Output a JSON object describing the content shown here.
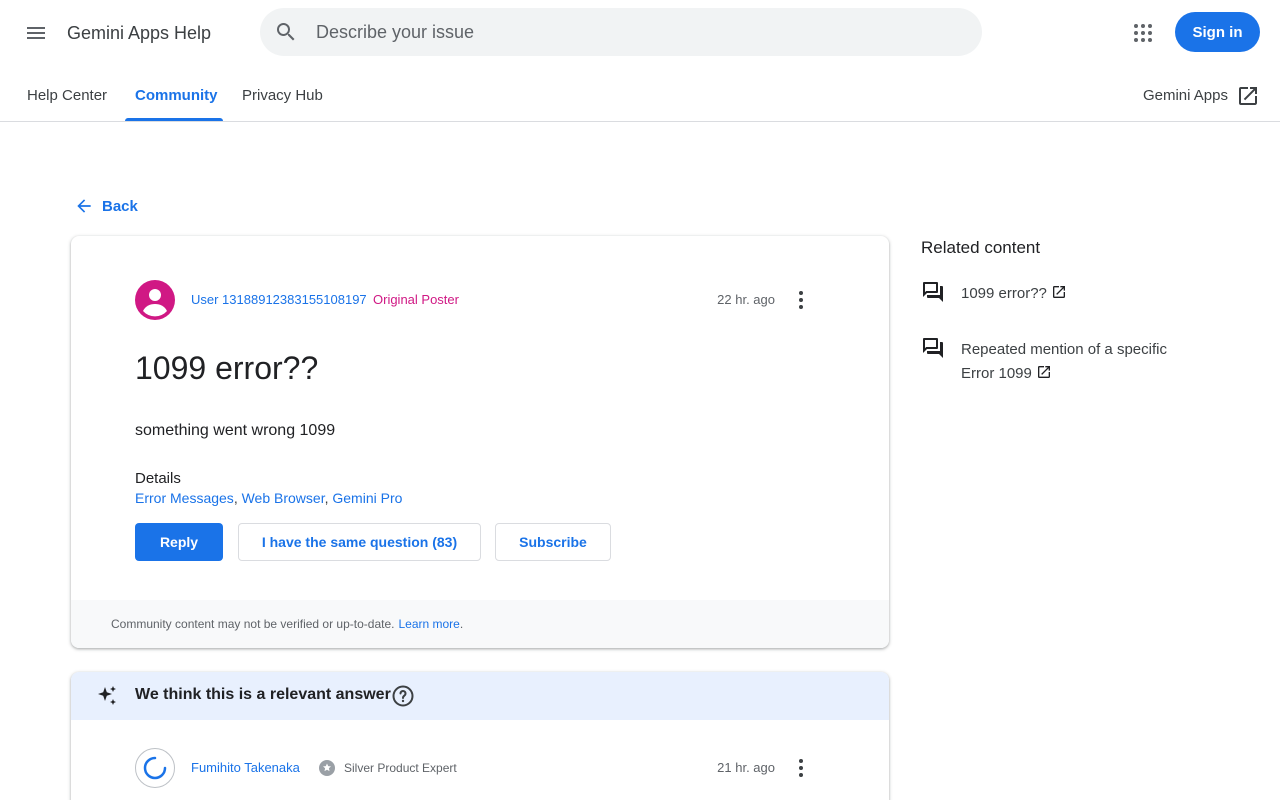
{
  "header": {
    "app_title": "Gemini Apps Help",
    "search_placeholder": "Describe your issue",
    "sign_in_label": "Sign in"
  },
  "nav": {
    "tabs": [
      {
        "label": "Help Center"
      },
      {
        "label": "Community"
      },
      {
        "label": "Privacy Hub"
      }
    ],
    "right_link": "Gemini Apps"
  },
  "back_label": "Back",
  "question": {
    "author": "User 13188912383155108197",
    "badge": "Original Poster",
    "time": "22 hr. ago",
    "title": "1099 error??",
    "body": "something went wrong 1099",
    "details_label": "Details",
    "details": [
      "Error Messages",
      "Web Browser",
      "Gemini Pro"
    ],
    "reply_label": "Reply",
    "same_question_label": "I have the same question (83)",
    "subscribe_label": "Subscribe",
    "footer_text": "Community content may not be verified or up-to-date.",
    "footer_link": "Learn more"
  },
  "answer": {
    "header": "We think this is a relevant answer",
    "author": "Fumihito Takenaka",
    "expert_label": "Silver Product Expert",
    "time": "21 hr. ago"
  },
  "related": {
    "title": "Related content",
    "items": [
      {
        "label": "1099 error??"
      },
      {
        "label": "Repeated mention of a specific Error 1099"
      }
    ]
  },
  "colors": {
    "accent": "#1a73e8",
    "op_badge": "#d01884",
    "answer_header_bg": "#e8f0fe"
  }
}
